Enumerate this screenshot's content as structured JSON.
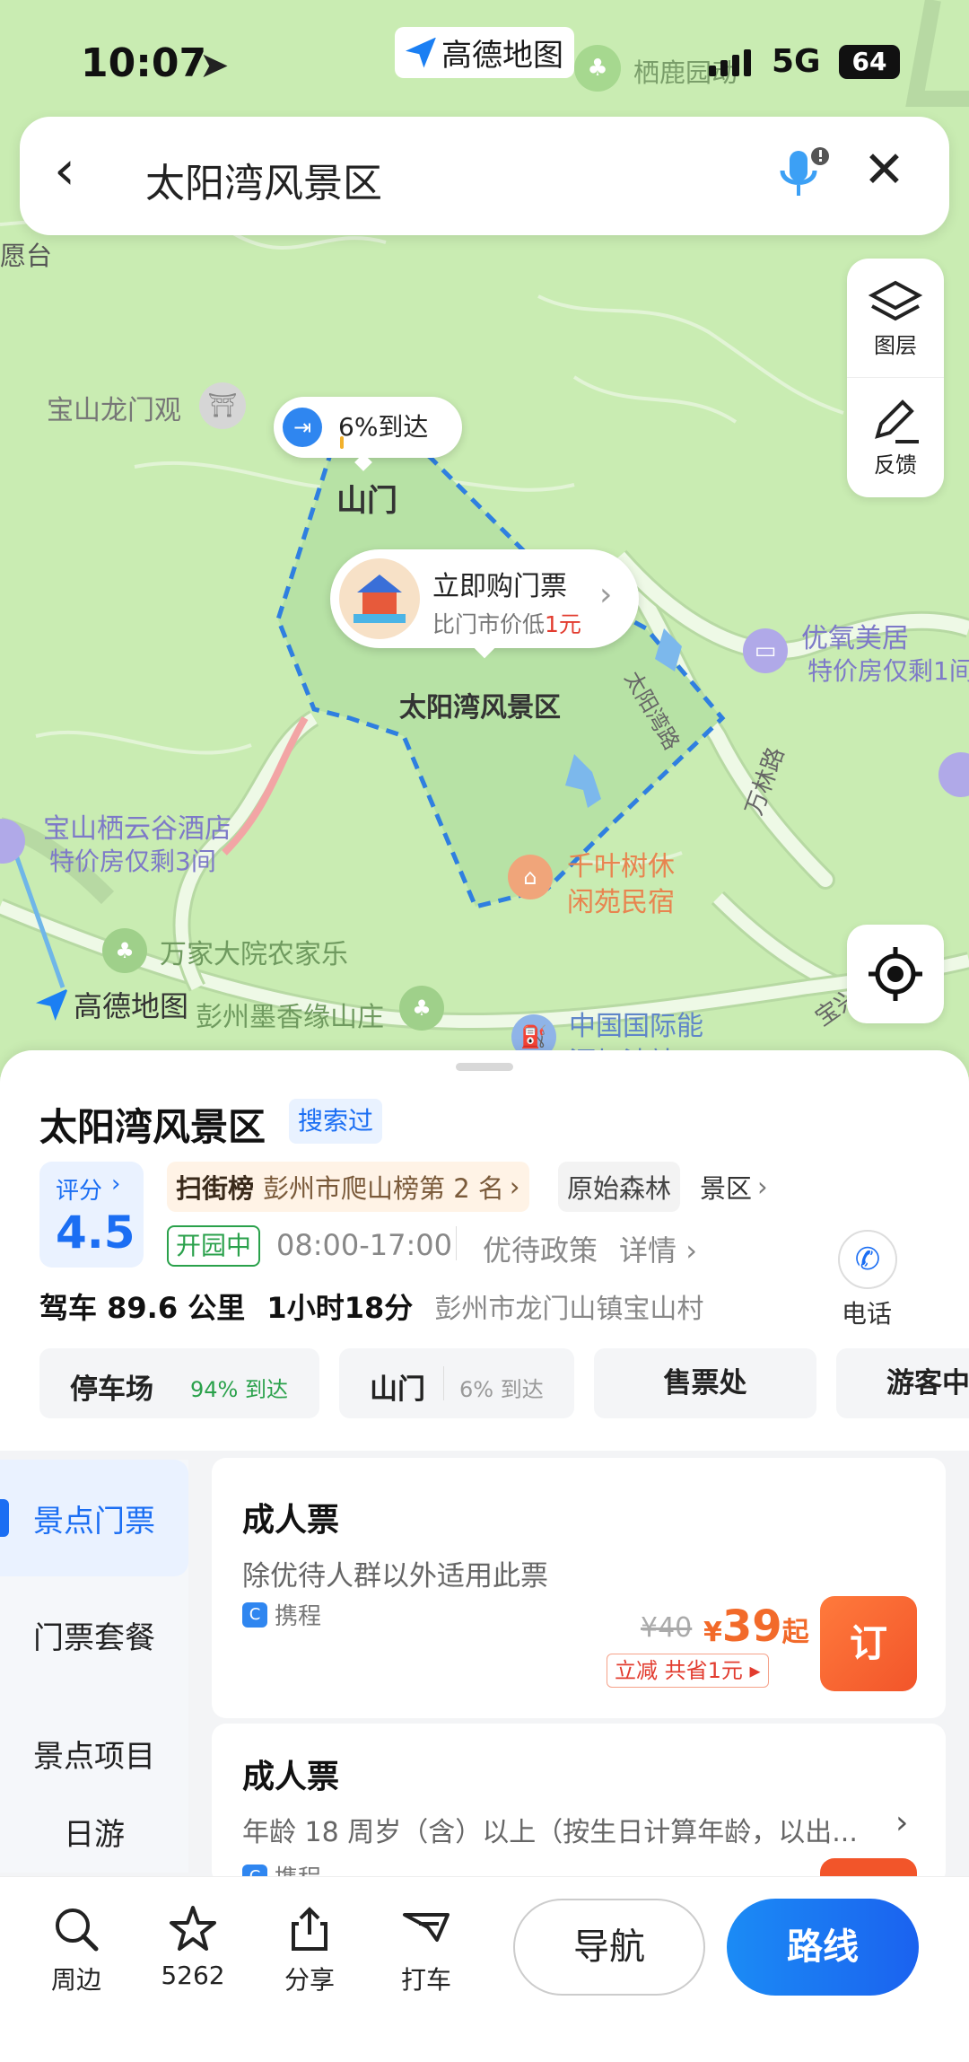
{
  "status": {
    "time": "10:07",
    "network": "5G",
    "battery": "64"
  },
  "brand": {
    "name": "高德地图"
  },
  "search": {
    "query": "太阳湾风景区"
  },
  "map_tools": {
    "layers": "图层",
    "feedback": "反馈"
  },
  "map": {
    "labels": {
      "baoshan_longmen": "宝山龙门观",
      "qilu": "栖鹿园动",
      "left_top": "愿台",
      "shanmen": "山门",
      "scenic_name": "太阳湾风景区",
      "youyang_name": "优氧美居",
      "youyang_sub": "特价房仅剩1间",
      "qiyun_name": "宝山栖云谷酒店",
      "qiyun_sub": "特价房仅剩3间",
      "qianye_1": "千叶树休",
      "qianye_2": "闲苑民宿",
      "wanjia": "万家大院农家乐",
      "moxiang": "彭州墨香缘山庄",
      "gas_1": "中国国际能",
      "gas_2": "源加油站",
      "road_1": "太阳湾路",
      "road_2": "万林路",
      "road_3": "宝兴",
      "watermark": "高德地图"
    },
    "arrival_callout": {
      "percent": "6%到达"
    },
    "ticket_callout": {
      "title": "立即购门票",
      "sub_prefix": "比门市价低",
      "sub_highlight": "1元"
    }
  },
  "place": {
    "name": "太阳湾风景区",
    "searched_badge": "搜索过",
    "score_label": "评分",
    "score": "4.5",
    "rank_tag": "扫街榜",
    "rank_text": "彭州市爬山榜第 2 名",
    "tag_forest": "原始森林",
    "tag_scenic": "景区",
    "open_status": "开园中",
    "hours": "08:00-17:00",
    "policy": "优待政策",
    "details": "详情",
    "phone_label": "电话",
    "drive": "驾车 89.6 公里",
    "duration": "1小时18分",
    "address": "彭州市龙门山镇宝山村"
  },
  "entrances": [
    {
      "name": "停车场",
      "pct": "94% 到达"
    },
    {
      "name": "山门",
      "pct": "6% 到达"
    },
    {
      "name": "售票处",
      "pct": ""
    },
    {
      "name": "游客中",
      "pct": ""
    }
  ],
  "left_nav": [
    "景点门票",
    "门票套餐",
    "景点项目",
    "日游"
  ],
  "tickets": [
    {
      "title": "成人票",
      "desc": "除优待人群以外适用此票",
      "source": "携程",
      "orig_price": "¥40",
      "price": "39",
      "price_currency": "¥",
      "price_suffix": "起",
      "discount": "立减 共省1元",
      "book": "订"
    },
    {
      "title": "成人票",
      "desc": "年龄 18 周岁（含）以上（按生日计算年龄，以出...",
      "source": "携程"
    }
  ],
  "bottom_bar": {
    "nearby": "周边",
    "favorites": "5262",
    "share": "分享",
    "taxi": "打车",
    "navigate": "导航",
    "route": "路线"
  },
  "colors": {
    "accent": "#1b6ef3",
    "map_bg": "#c9ecb2",
    "price": "#f26a2a",
    "book": "#f26a2a"
  }
}
